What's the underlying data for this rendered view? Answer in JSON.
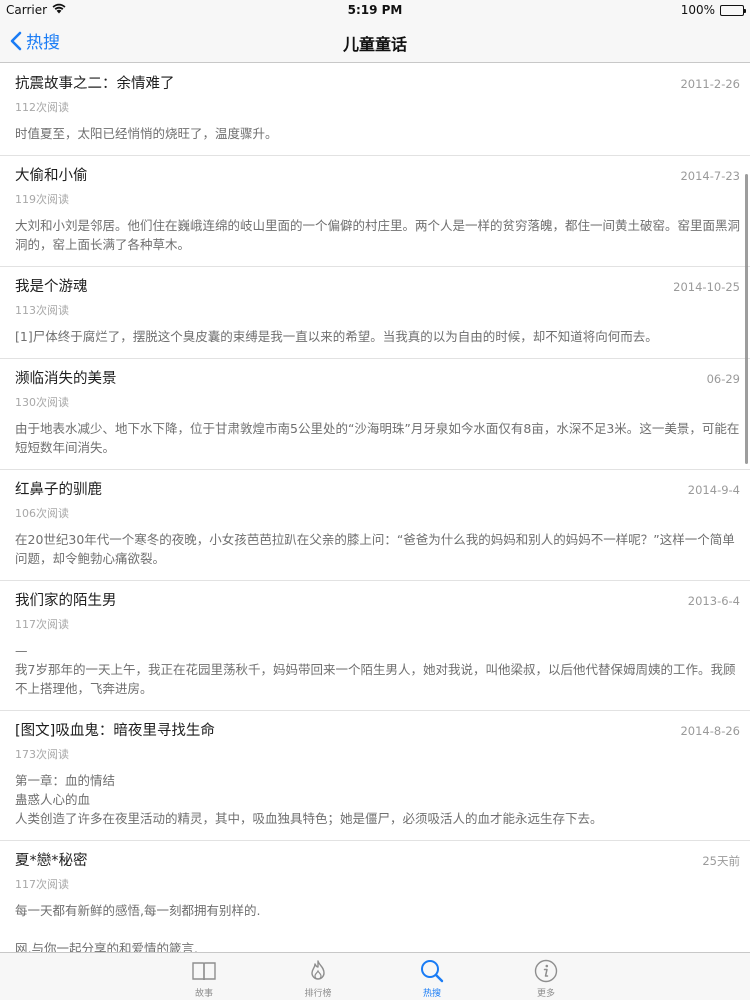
{
  "status_bar": {
    "carrier": "Carrier",
    "time": "5:19 PM",
    "battery": "100%",
    "battery_level": 1.0
  },
  "nav": {
    "back_label": "热搜",
    "title": "儿童童话"
  },
  "articles": [
    {
      "title": "抗震故事之二：余情难了",
      "date": "2011-2-26",
      "reads": "112次阅读",
      "desc": "时值夏至，太阳已经悄悄的烧旺了，温度骤升。"
    },
    {
      "title": "大偷和小偷",
      "date": "2014-7-23",
      "reads": "119次阅读",
      "desc": "大刘和小刘是邻居。他们住在巍峨连绵的岐山里面的一个偏僻的村庄里。两个人是一样的贫穷落魄，都住一间黄土破窑。窑里面黑洞洞的，窑上面长满了各种草木。"
    },
    {
      "title": "我是个游魂",
      "date": "2014-10-25",
      "reads": "113次阅读",
      "desc": "[1]尸体终于腐烂了，摆脱这个臭皮囊的束缚是我一直以来的希望。当我真的以为自由的时候，却不知道将向何而去。"
    },
    {
      "title": "濒临消失的美景",
      "date": "06-29",
      "reads": "130次阅读",
      "desc": "由于地表水减少、地下水下降，位于甘肃敦煌市南5公里处的“沙海明珠”月牙泉如今水面仅有8亩，水深不足3米。这一美景，可能在短短数年间消失。"
    },
    {
      "title": "红鼻子的驯鹿",
      "date": "2014-9-4",
      "reads": "106次阅读",
      "desc": "在20世纪30年代一个寒冬的夜晚，小女孩芭芭拉趴在父亲的膝上问：“爸爸为什么我的妈妈和别人的妈妈不一样呢？”这样一个简单问题，却令鲍勃心痛欲裂。"
    },
    {
      "title": "我们家的陌生男",
      "date": "2013-6-4",
      "reads": "117次阅读",
      "desc": "—\n我7岁那年的一天上午，我正在花园里荡秋千，妈妈带回来一个陌生男人，她对我说，叫他梁叔，以后他代替保姆周姨的工作。我顾不上搭理他，飞奔进房。"
    },
    {
      "title": "[图文]吸血鬼：暗夜里寻找生命",
      "date": "2014-8-26",
      "reads": "173次阅读",
      "desc": "第一章：血的情结\n蛊惑人心的血\n人类创造了许多在夜里活动的精灵，其中，吸血独具特色；她是僵尸，必须吸活人的血才能永远生存下去。"
    },
    {
      "title": "夏*戀*秘密",
      "date": "25天前",
      "reads": "117次阅读",
      "desc": "每一天都有新鲜的感悟,每一刻都拥有别样的.\n\n网,与你一起分享的和爱情的箴言."
    }
  ],
  "tabs": [
    {
      "label": "故事",
      "icon": "book-icon",
      "active": false
    },
    {
      "label": "排行榜",
      "icon": "flame-icon",
      "active": false
    },
    {
      "label": "热搜",
      "icon": "search-icon",
      "active": true
    },
    {
      "label": "更多",
      "icon": "info-icon",
      "active": false
    }
  ],
  "colors": {
    "accent": "#1a7cf5",
    "inactive": "#8e8e8e"
  }
}
